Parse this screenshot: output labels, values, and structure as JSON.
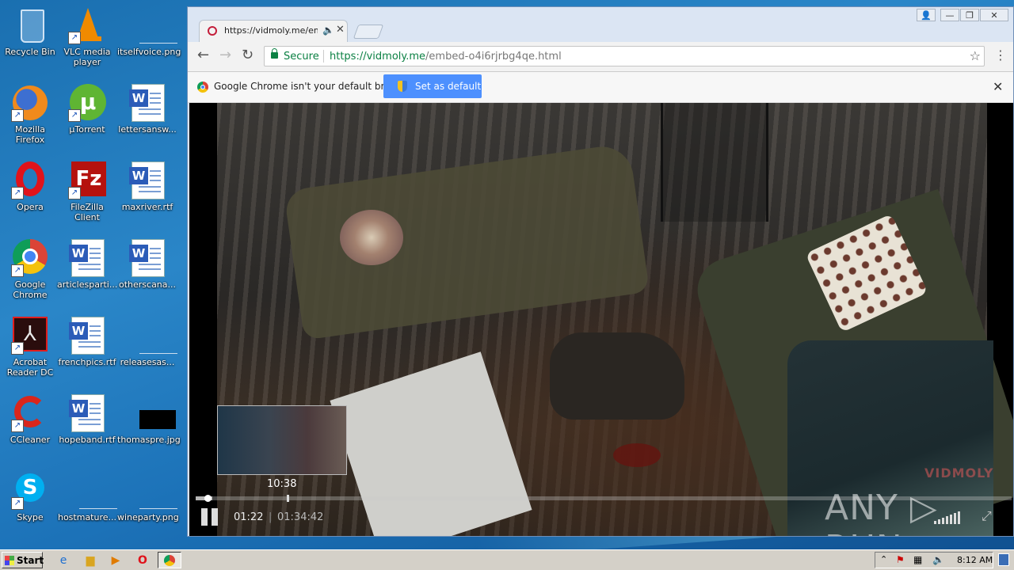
{
  "desktop": {
    "icons": [
      {
        "label": "Recycle Bin"
      },
      {
        "label": "VLC media player"
      },
      {
        "label": "itselfvoice.png"
      },
      {
        "label": "Mozilla Firefox"
      },
      {
        "label": "µTorrent"
      },
      {
        "label": "lettersansw..."
      },
      {
        "label": "Opera"
      },
      {
        "label": "FileZilla Client"
      },
      {
        "label": "maxriver.rtf"
      },
      {
        "label": "Google Chrome"
      },
      {
        "label": "articlesparti..."
      },
      {
        "label": "otherscana..."
      },
      {
        "label": "Acrobat Reader DC"
      },
      {
        "label": "frenchpics.rtf"
      },
      {
        "label": "releasesas..."
      },
      {
        "label": "CCleaner"
      },
      {
        "label": "hopeband.rtf"
      },
      {
        "label": "thomaspre.jpg"
      },
      {
        "label": "Skype"
      },
      {
        "label": "hostmature..."
      },
      {
        "label": "wineparty.png"
      }
    ]
  },
  "browser": {
    "tab_title": "https://vidmoly.me/emb",
    "address": {
      "secure_label": "Secure",
      "scheme": "https://",
      "host": "vidmoly.me",
      "path": "/embed-o4i6rjrbg4qe.html"
    },
    "infobar": {
      "message": "Google Chrome isn't your default browser.",
      "button_label": "Set as default"
    }
  },
  "player": {
    "hover_time": "10:38",
    "current_time": "01:22",
    "separator": "|",
    "duration": "01:34:42",
    "progress": 0.015,
    "buffered": 0.02,
    "hover_position": 0.112,
    "brand": "VIDMOLY"
  },
  "watermark": "ANY ▷ RUN",
  "taskbar": {
    "start_label": "Start",
    "clock": "8:12 AM"
  }
}
